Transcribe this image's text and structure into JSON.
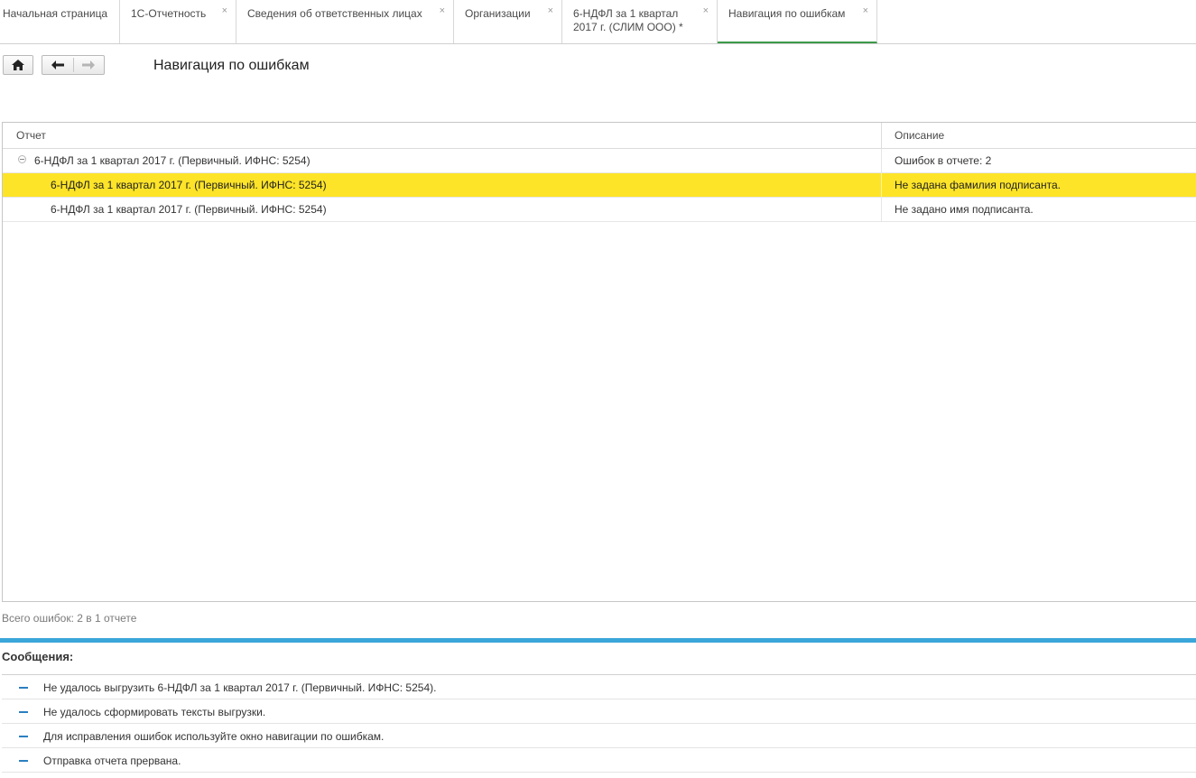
{
  "tabs": [
    {
      "label": "Начальная страница",
      "closable": false
    },
    {
      "label": "1С-Отчетность",
      "closable": true
    },
    {
      "label": "Сведения об ответственных лицах",
      "closable": true
    },
    {
      "label": "Организации",
      "closable": true
    },
    {
      "label": "6-НДФЛ за 1 квартал 2017 г. (СЛИМ ООО) *",
      "line1": "6-НДФЛ за 1 квартал",
      "line2": "2017 г. (СЛИМ ООО) *",
      "closable": true
    },
    {
      "label": "Навигация по ошибкам",
      "closable": true,
      "active": true
    }
  ],
  "tab_close_glyph": "×",
  "toolbar": {
    "home_icon": "home-icon",
    "back_icon": "arrow-left-icon",
    "forward_icon": "arrow-right-icon"
  },
  "page_title": "Навигация по ошибкам",
  "grid": {
    "columns": [
      "Отчет",
      "Описание"
    ],
    "rows": [
      {
        "report": "6-НДФЛ за 1 квартал 2017 г. (Первичный. ИФНС: 5254)",
        "description": "Ошибок в отчете: 2",
        "level": 0,
        "expanded": true
      },
      {
        "report": "6-НДФЛ за 1 квартал 2017 г. (Первичный. ИФНС: 5254)",
        "description": "Не задана фамилия подписанта.",
        "level": 1,
        "selected": true
      },
      {
        "report": "6-НДФЛ за 1 квартал 2017 г. (Первичный. ИФНС: 5254)",
        "description": "Не задано имя подписанта.",
        "level": 1
      }
    ]
  },
  "total_errors": "Всего ошибок: 2 в 1 отчете",
  "messages": {
    "title": "Сообщения:",
    "items": [
      "Не удалось выгрузить 6-НДФЛ за 1 квартал 2017 г. (Первичный. ИФНС: 5254).",
      "Не удалось сформировать тексты выгрузки.",
      "Для исправления ошибок используйте окно навигации по ошибкам.",
      "Отправка отчета прервана."
    ]
  },
  "colors": {
    "selected_row": "#fde428",
    "active_tab_underline": "#3d9a4a",
    "separator_blue": "#3aa6d9",
    "message_dash": "#2b7fc0"
  }
}
